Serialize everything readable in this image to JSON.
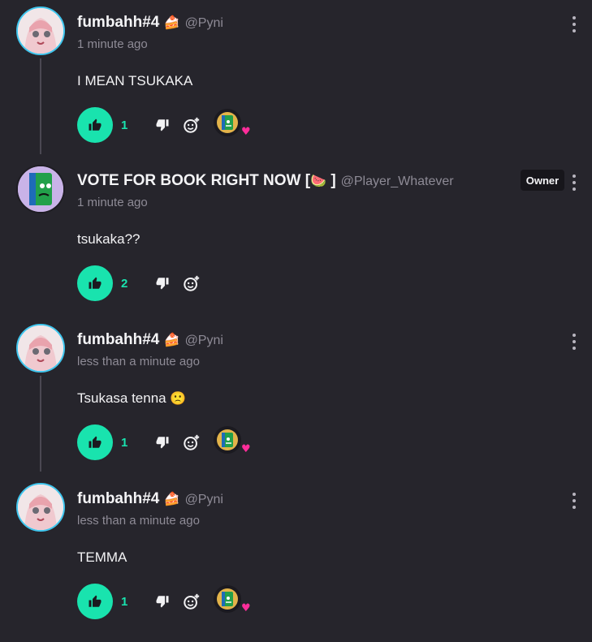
{
  "comments": [
    {
      "username": "fumbahh#4",
      "username_emoji": "🍰",
      "handle": "@Pyni",
      "time": "1 minute ago",
      "body": "I MEAN TSUKAKA",
      "likes": "1",
      "has_reaction": true
    },
    {
      "username": "VOTE FOR BOOK RIGHT NOW [",
      "username_emoji": "🍉",
      "username_suffix": "]",
      "handle": "@Player_Whatever",
      "badge": "Owner",
      "time": "1 minute ago",
      "body": "tsukaka??",
      "likes": "2",
      "has_reaction": false
    },
    {
      "username": "fumbahh#4",
      "username_emoji": "🍰",
      "handle": "@Pyni",
      "time": "less than a minute ago",
      "body": "Tsukasa tenna",
      "body_emoji": "🙁",
      "likes": "1",
      "has_reaction": true
    },
    {
      "username": "fumbahh#4",
      "username_emoji": "🍰",
      "handle": "@Pyni",
      "time": "less than a minute ago",
      "body": "TEMMA",
      "likes": "1",
      "has_reaction": true
    }
  ],
  "icons": {
    "like": "thumbs-up-icon",
    "dislike": "thumbs-down-icon",
    "react": "add-reaction-icon",
    "more": "more-vertical-icon",
    "reaction_heart": "♥"
  },
  "colors": {
    "background": "#26252c",
    "accent": "#19e3ae",
    "ring": "#3fc6ee",
    "heart": "#ff2d9a"
  }
}
